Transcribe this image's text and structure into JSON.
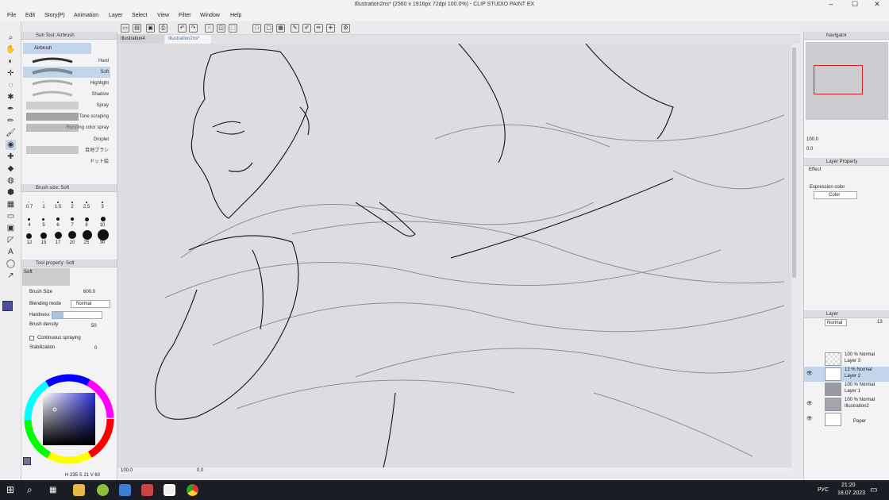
{
  "window": {
    "title": "Illustration2ns* (2560 x 1916px 72dpi 100.0%)  - CLIP STUDIO PAINT EX"
  },
  "menu": [
    "File",
    "Edit",
    "Story(P)",
    "Animation",
    "Layer",
    "Select",
    "View",
    "Filter",
    "Window",
    "Help"
  ],
  "tabs": [
    {
      "label": "Illustration4",
      "active": false
    },
    {
      "label": "Illustration2ns*",
      "active": true
    }
  ],
  "subtool": {
    "header": "Sub Tool: Airbrush",
    "group": "Airbrush",
    "brushes": [
      "Hard",
      "Soft",
      "Highlight",
      "Shadow",
      "Spray",
      "Tone scraping",
      "Running color spray",
      "Droplet",
      "目地ブラシ",
      "ドット絵"
    ]
  },
  "brushsize": {
    "header": "Brush size: Soft",
    "sizes": [
      "0.7",
      "1",
      "1.5",
      "2",
      "2.5",
      "3",
      "4",
      "5",
      "6",
      "7",
      "8",
      "10",
      "12",
      "15",
      "17",
      "20",
      "25",
      "30"
    ]
  },
  "toolprop": {
    "header": "Tool property: Soft",
    "name": "Soft",
    "brush_size_label": "Brush Size",
    "brush_size_value": "600.0",
    "blending_label": "Blending mode",
    "blending_value": "Normal",
    "hardness_label": "Hardness",
    "density_label": "Brush density",
    "density_value": "50",
    "continuous_label": "Continuous spraying",
    "stabilization_label": "Stabilization",
    "stabilization_value": "0"
  },
  "color": {
    "h": "235",
    "s": "21",
    "v": "60",
    "accent": "#4a4f9a"
  },
  "navigator": {
    "header": "Navigator",
    "zoom": "100.0",
    "angle": "0.0"
  },
  "layerprop": {
    "header": "Layer Property",
    "effect": "Effect",
    "expression": "Expression color",
    "color_value": "Color"
  },
  "layer": {
    "header": "Layer",
    "blend": "Normal",
    "opacity": "13",
    "items": [
      {
        "pct": "100 % Normal",
        "name": "Layer 3",
        "selected": false
      },
      {
        "pct": "13 % Normal",
        "name": "Layer 2",
        "selected": true
      },
      {
        "pct": "100 % Normal",
        "name": "Layer 1",
        "selected": false
      },
      {
        "pct": "100 % Normal",
        "name": "Illustration2",
        "selected": false
      },
      {
        "pct": "",
        "name": "Paper",
        "selected": false
      }
    ]
  },
  "status": {
    "zoom": "100.0",
    "angle": "0.0"
  },
  "taskbar": {
    "lang": "РУС",
    "time": "21:20",
    "date": "18.07.2023"
  }
}
